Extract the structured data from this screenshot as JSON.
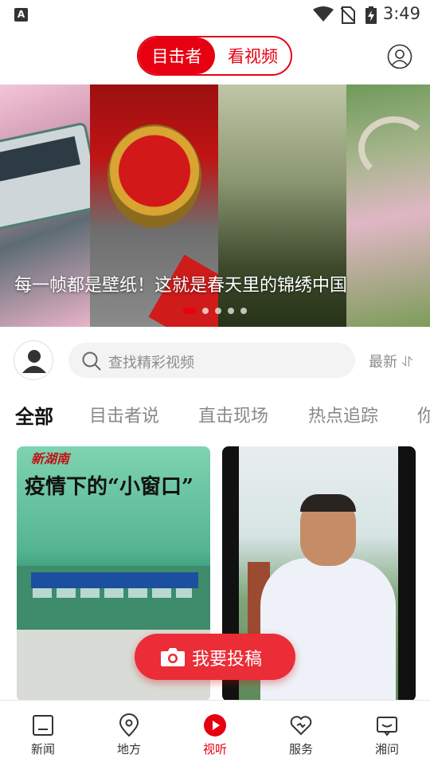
{
  "status_bar": {
    "time": "3:49",
    "notification_letter": "A"
  },
  "header": {
    "segments": [
      {
        "label": "目击者",
        "active": true
      },
      {
        "label": "看视频",
        "active": false
      }
    ],
    "profile_icon": "user-circle-icon",
    "accent_color": "#e60012"
  },
  "banner": {
    "title": "每一帧都是壁纸！这就是春天里的锦绣中国",
    "dots_total": 5,
    "active_dot": 1
  },
  "search": {
    "placeholder": "查找精彩视频",
    "sort_label": "最新 ⥯"
  },
  "tabs": [
    "全部",
    "目击者说",
    "直击现场",
    "热点追踪",
    "你"
  ],
  "cards": [
    {
      "headline": "疫情下的“小窗口”",
      "logo_text": "新湖南"
    },
    {
      "headline": ""
    }
  ],
  "fab": {
    "label": "我要投稿",
    "icon": "camera-icon"
  },
  "bottom_nav": [
    {
      "label": "新闻",
      "icon": "news-icon",
      "active": false
    },
    {
      "label": "地方",
      "icon": "location-pin-icon",
      "active": false
    },
    {
      "label": "视听",
      "icon": "play-icon",
      "active": true
    },
    {
      "label": "服务",
      "icon": "heart-icon",
      "active": false
    },
    {
      "label": "湘问",
      "icon": "message-icon",
      "active": false
    }
  ]
}
